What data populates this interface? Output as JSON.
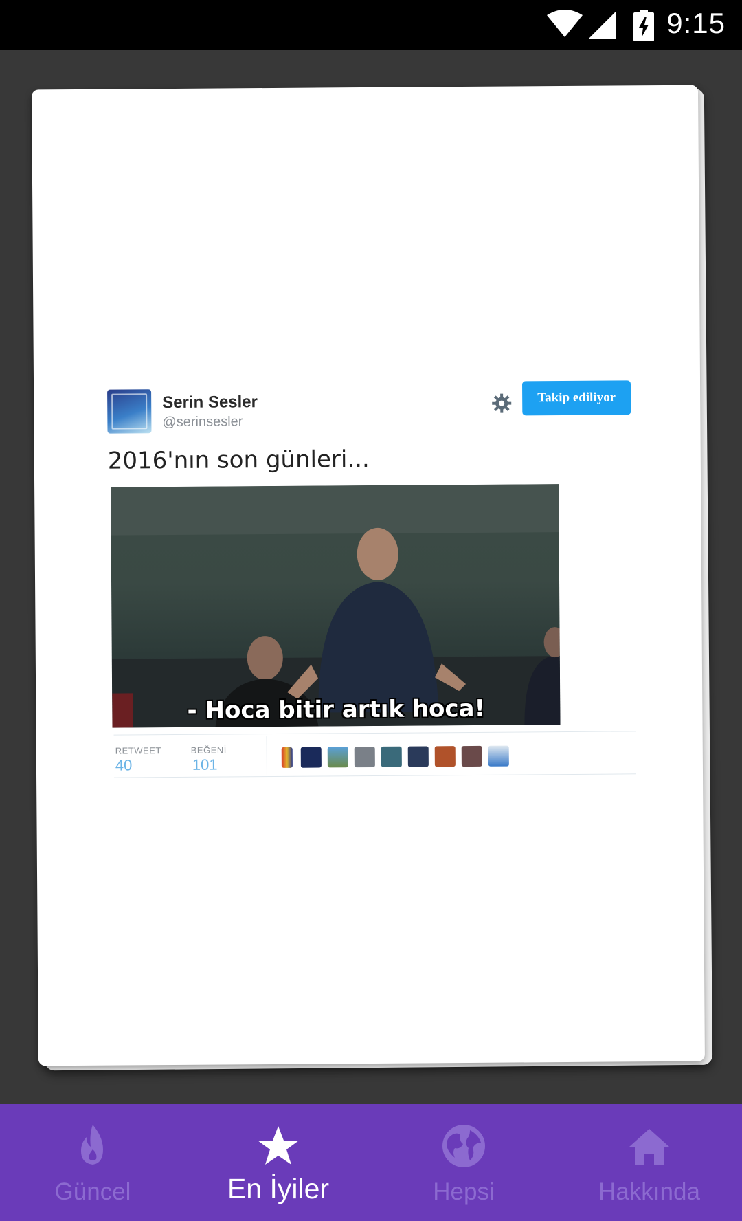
{
  "status_bar": {
    "time": "9:15",
    "icons": [
      "wifi-icon",
      "signal-icon",
      "battery-charging-icon"
    ]
  },
  "tweet": {
    "user_name": "Serin Sesler",
    "user_handle": "@serinsesler",
    "follow_button_label": "Takip ediliyor",
    "text": "2016'nın son günleri...",
    "media_caption": "- Hoca bitir artık hoca!",
    "stats": {
      "retweet_label": "RETWEET",
      "retweet_count": "40",
      "like_label": "BEĞENİ",
      "like_count": "101"
    },
    "liker_avatars": 9
  },
  "bottom_nav": {
    "items": [
      {
        "label": "Güncel",
        "icon": "flame-icon",
        "active": false
      },
      {
        "label": "En İyiler",
        "icon": "star-icon",
        "active": true
      },
      {
        "label": "Hepsi",
        "icon": "globe-icon",
        "active": false
      },
      {
        "label": "Hakkında",
        "icon": "home-icon",
        "active": false
      }
    ]
  },
  "colors": {
    "nav_background": "#6a3bb9",
    "nav_inactive": "#8c6ad0",
    "nav_active": "#ffffff",
    "follow_button": "#1da1f2",
    "app_background": "#383838"
  }
}
